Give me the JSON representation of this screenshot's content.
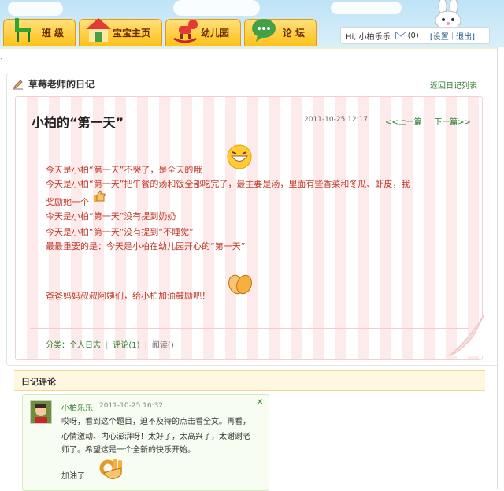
{
  "nav": {
    "tabs": [
      {
        "label": "班 级",
        "icon": "chair-icon"
      },
      {
        "label": "宝宝主页",
        "icon": "house-icon"
      },
      {
        "label": "幼儿园",
        "icon": "rocking-horse-icon"
      },
      {
        "label": "论 坛",
        "icon": "speech-bubble-icon"
      }
    ]
  },
  "user": {
    "greeting": "Hi, 小柏乐乐",
    "mail_count": "(0)",
    "settings": "[设置",
    "logout": "退出]"
  },
  "panel": {
    "title": "草莓老师的日记",
    "back_link": "返回日记列表"
  },
  "diary": {
    "title": "小柏的“第一天”",
    "date": "2011-10-25 12:17",
    "prev": "<<上一篇",
    "next": "下一篇>>",
    "lines": [
      "今天是小柏“第一天”不哭了，是全天的哦",
      "今天是小柏“第一天”把午餐的汤和饭全部吃完了，最主要是汤，里面有些香菜和冬瓜、虾皮，我",
      "奖励她一个",
      "今天是小柏“第一天”没有提到奶奶",
      "今天是小柏“第一天”没有提到“不睡觉”",
      "最最重要的是：今天是小柏在幼儿园开心的“第一天”",
      "爸爸妈妈叔叔阿姨们，给小柏加油鼓励吧！"
    ],
    "category": "分类：个人日志",
    "comments": "评论(1)",
    "reads": "阅读()"
  },
  "comments_section": {
    "title": "日记评论",
    "items": [
      {
        "author": "小柏乐乐",
        "time": "2011-10-25 16:32",
        "lines": [
          "哎呀，看到这个题目，迫不及待的点击看全文。再看，",
          "心情激动、内心澎湃呀！太好了，太高兴了，太谢谢老",
          "师了。希望这是一个全新的快乐开始。",
          "加油了！"
        ]
      }
    ]
  },
  "colors": {
    "accent_green": "#2e7d32",
    "diary_red": "#c0392b",
    "tab_yellow": "#ffc21a"
  }
}
